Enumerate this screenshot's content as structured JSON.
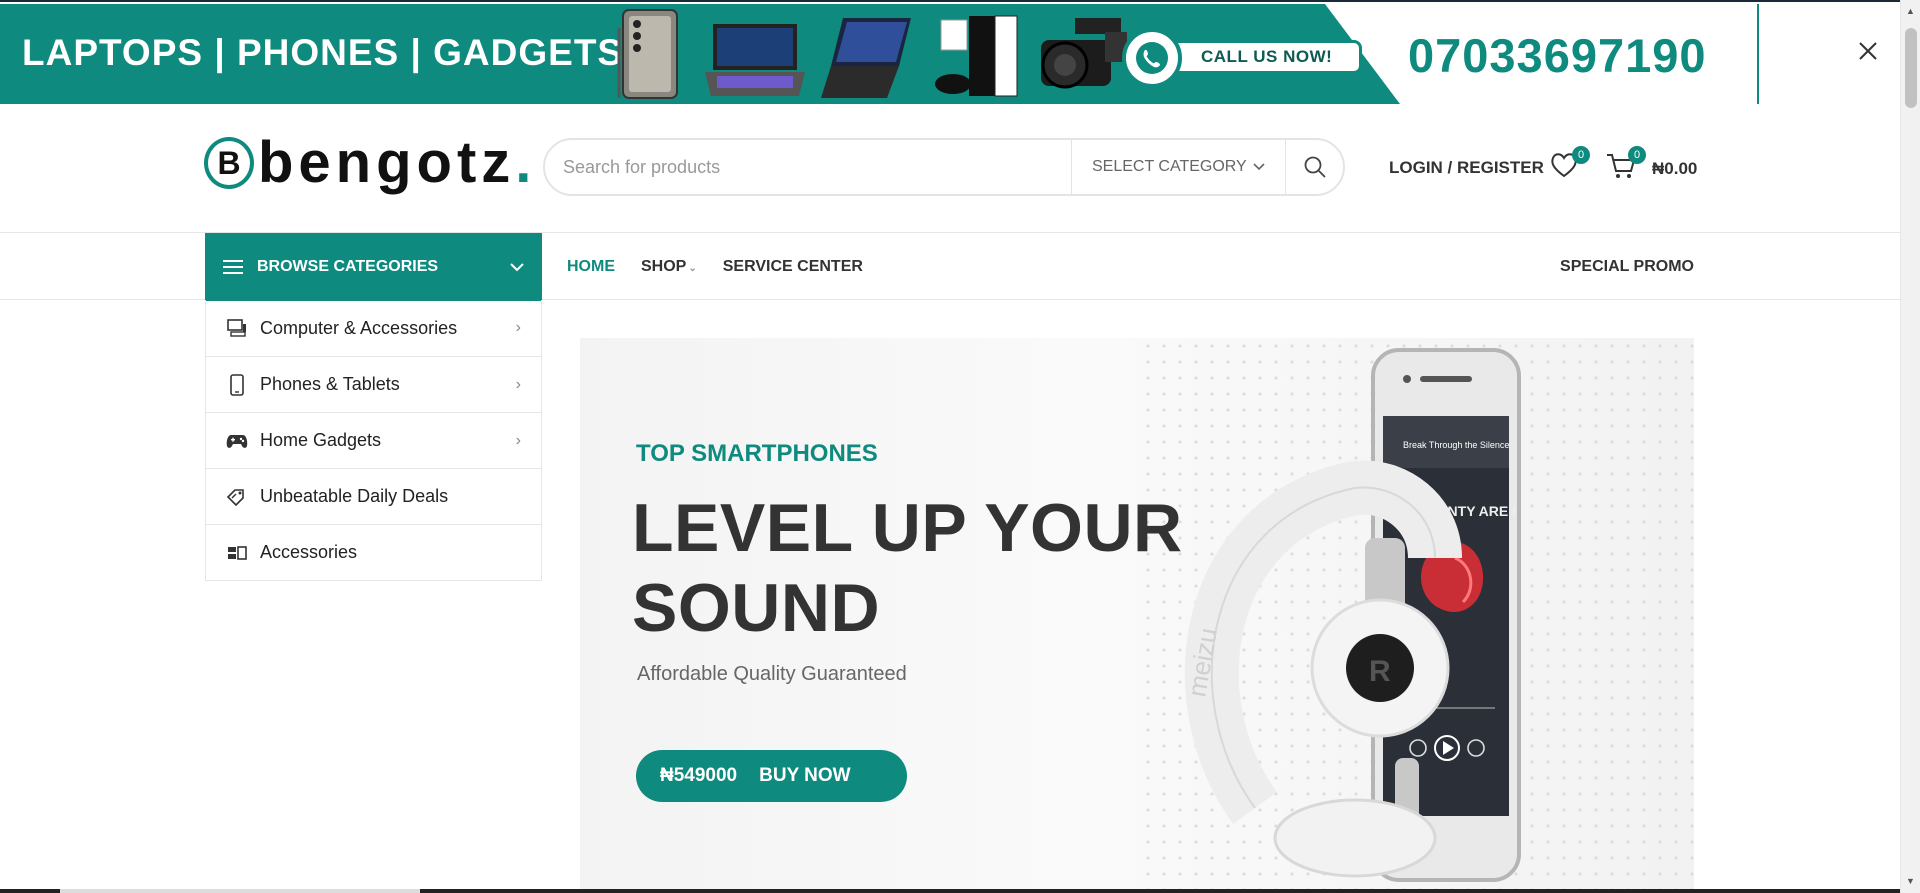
{
  "promo": {
    "title": "LAPTOPS | PHONES | GADGETS",
    "call_label": "CALL US NOW!",
    "phone": "07033697190",
    "accent_color": "#0e8a7e"
  },
  "header": {
    "logo_text": "bengotz",
    "logo_dot": ".",
    "logo_mark": "B",
    "search_placeholder": "Search for products",
    "category_select": "SELECT CATEGORY",
    "login": "LOGIN / REGISTER",
    "wishlist_count": "0",
    "cart_count": "0",
    "cart_total": "₦0.00"
  },
  "nav": {
    "browse_label": "BROWSE CATEGORIES",
    "links": [
      "HOME",
      "SHOP",
      "SERVICE CENTER"
    ],
    "special": "SPECIAL PROMO"
  },
  "categories": [
    {
      "label": "Computer & Accessories",
      "icon": "computer-icon"
    },
    {
      "label": "Phones & Tablets",
      "icon": "phone-icon"
    },
    {
      "label": "Home Gadgets",
      "icon": "gamepad-icon"
    },
    {
      "label": "Unbeatable Daily Deals",
      "icon": "deal-tag-icon"
    },
    {
      "label": "Accessories",
      "icon": "accessories-icon"
    }
  ],
  "hero": {
    "eyebrow": "TOP SMARTPHONES",
    "title": "LEVEL UP YOUR SOUND",
    "subtitle": "Affordable Quality Guaranteed",
    "price": "₦549000",
    "cta": "BUY NOW",
    "phone_screen_song": "Break Through the Silence",
    "phone_screen_album": "MONTY ARE I",
    "headphone_brand": "meizu"
  }
}
